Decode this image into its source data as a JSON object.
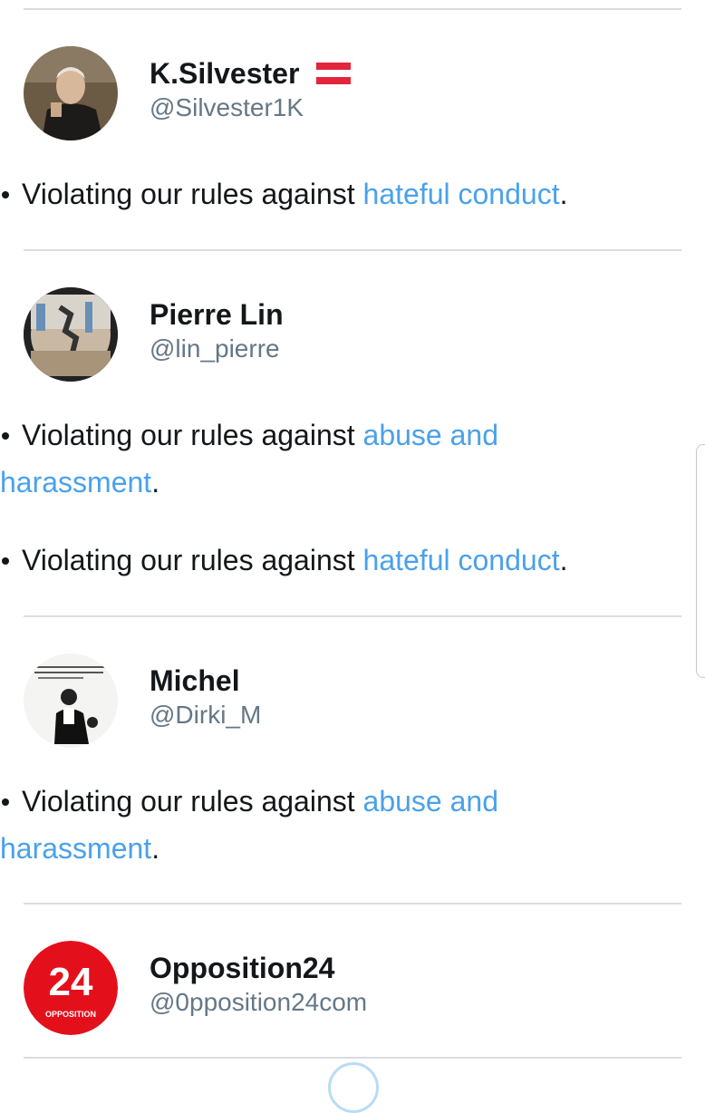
{
  "colors": {
    "link": "#4aa1eb",
    "name": "#14171a",
    "handle": "#657786",
    "divider": "#d9dcdf"
  },
  "accounts": [
    {
      "name": "K.Silvester",
      "flag_icon": "austria-flag-icon",
      "handle": "@Silvester1K",
      "reasons": [
        {
          "prefix": "Violating our rules against ",
          "link": "hateful conduct",
          "suffix": "."
        }
      ]
    },
    {
      "name": "Pierre Lin",
      "handle": "@lin_pierre",
      "reasons": [
        {
          "prefix": "Violating our rules against ",
          "link": "abuse and harassment",
          "suffix": "."
        },
        {
          "prefix": "Violating our rules against ",
          "link": "hateful conduct",
          "suffix": "."
        }
      ]
    },
    {
      "name": "Michel",
      "handle": "@Dirki_M",
      "reasons": [
        {
          "prefix": "Violating our rules against ",
          "link": "abuse and harassment",
          "suffix": "."
        }
      ]
    },
    {
      "name": "Opposition24",
      "handle": "@0pposition24com",
      "avatar_logo_text": [
        "24",
        "OPPOSITION"
      ],
      "reasons": []
    }
  ],
  "icons": {
    "loading": "loading-spinner-icon"
  }
}
